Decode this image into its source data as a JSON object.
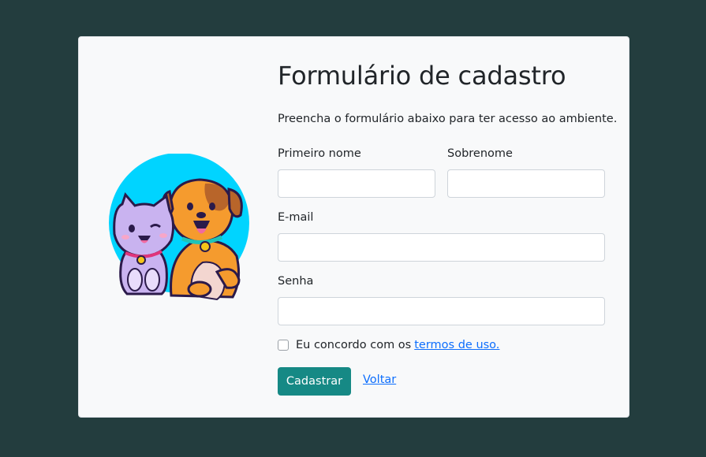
{
  "form": {
    "title": "Formulário de cadastro",
    "subtitle": "Preencha o formulário abaixo para ter acesso ao ambiente.",
    "first_name": {
      "label": "Primeiro nome",
      "value": "",
      "placeholder": ""
    },
    "last_name": {
      "label": "Sobrenome",
      "value": "",
      "placeholder": ""
    },
    "email": {
      "label": "E-mail",
      "value": "",
      "placeholder": ""
    },
    "password": {
      "label": "Senha",
      "value": "",
      "placeholder": ""
    },
    "terms": {
      "text": "Eu concordo com os",
      "link_text": "termos de uso.",
      "checked": false
    },
    "submit_label": "Cadastrar",
    "back_label": "Voltar"
  },
  "illustration": {
    "icon": "cat-and-dog-illustration"
  },
  "colors": {
    "background": "#233d3e",
    "card": "#f8f9fa",
    "primary_button": "#168985",
    "link": "#0d6efd",
    "illustration_circle": "#00d4ff"
  }
}
